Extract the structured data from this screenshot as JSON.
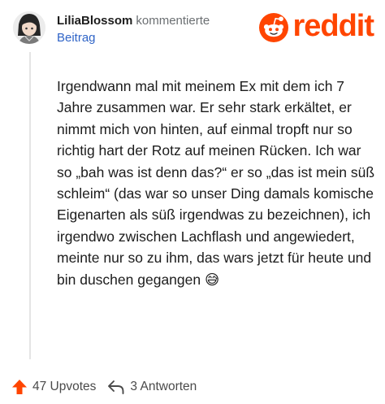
{
  "comment": {
    "author": "LiliaBlossom",
    "action": "kommentierte",
    "target": "Beitrag",
    "body": "Irgendwann mal mit meinem Ex mit dem ich 7 Jahre zusammen war. Er sehr stark erkältet, er nimmt mich von hinten, auf einmal tropft nur so richtig hart der Rotz auf meinen Rücken. Ich war so „bah was ist denn das?“ er so „das ist mein süß schleim“ (das war so unser Ding damals komische Eigenarten als süß irgendwas zu bezeichnen), ich irgendwo zwischen Lachflash und angewiedert, meinte nur so zu ihm, das wars jetzt für heute und bin duschen gegangen 😅"
  },
  "brand": {
    "name": "reddit",
    "color": "#ff4500",
    "icon": "reddit-snoo-icon"
  },
  "footer": {
    "upvotes_label": "47 Upvotes",
    "replies_label": "3 Antworten",
    "upvote_icon": "upvote-arrow-icon",
    "reply_icon": "reply-arrow-icon",
    "upvote_color": "#ff4500"
  },
  "colors": {
    "link": "#2f64c7",
    "muted": "#6b6f72",
    "text": "#1c1c1c",
    "thread_line": "#e5e5e5"
  }
}
